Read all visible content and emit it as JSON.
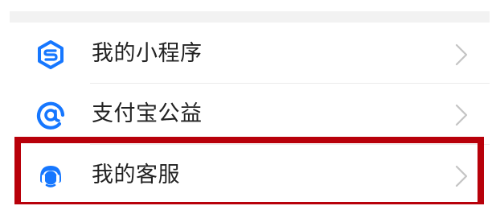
{
  "menu": {
    "items": [
      {
        "label": "我的小程序",
        "icon": "mini-program-icon"
      },
      {
        "label": "支付宝公益",
        "icon": "charity-icon"
      },
      {
        "label": "我的客服",
        "icon": "customer-service-icon"
      }
    ]
  },
  "colors": {
    "icon_blue": "#1677ff",
    "highlight_red": "#b8000a",
    "chevron_gray": "#c4c4c4",
    "text": "#222222"
  }
}
